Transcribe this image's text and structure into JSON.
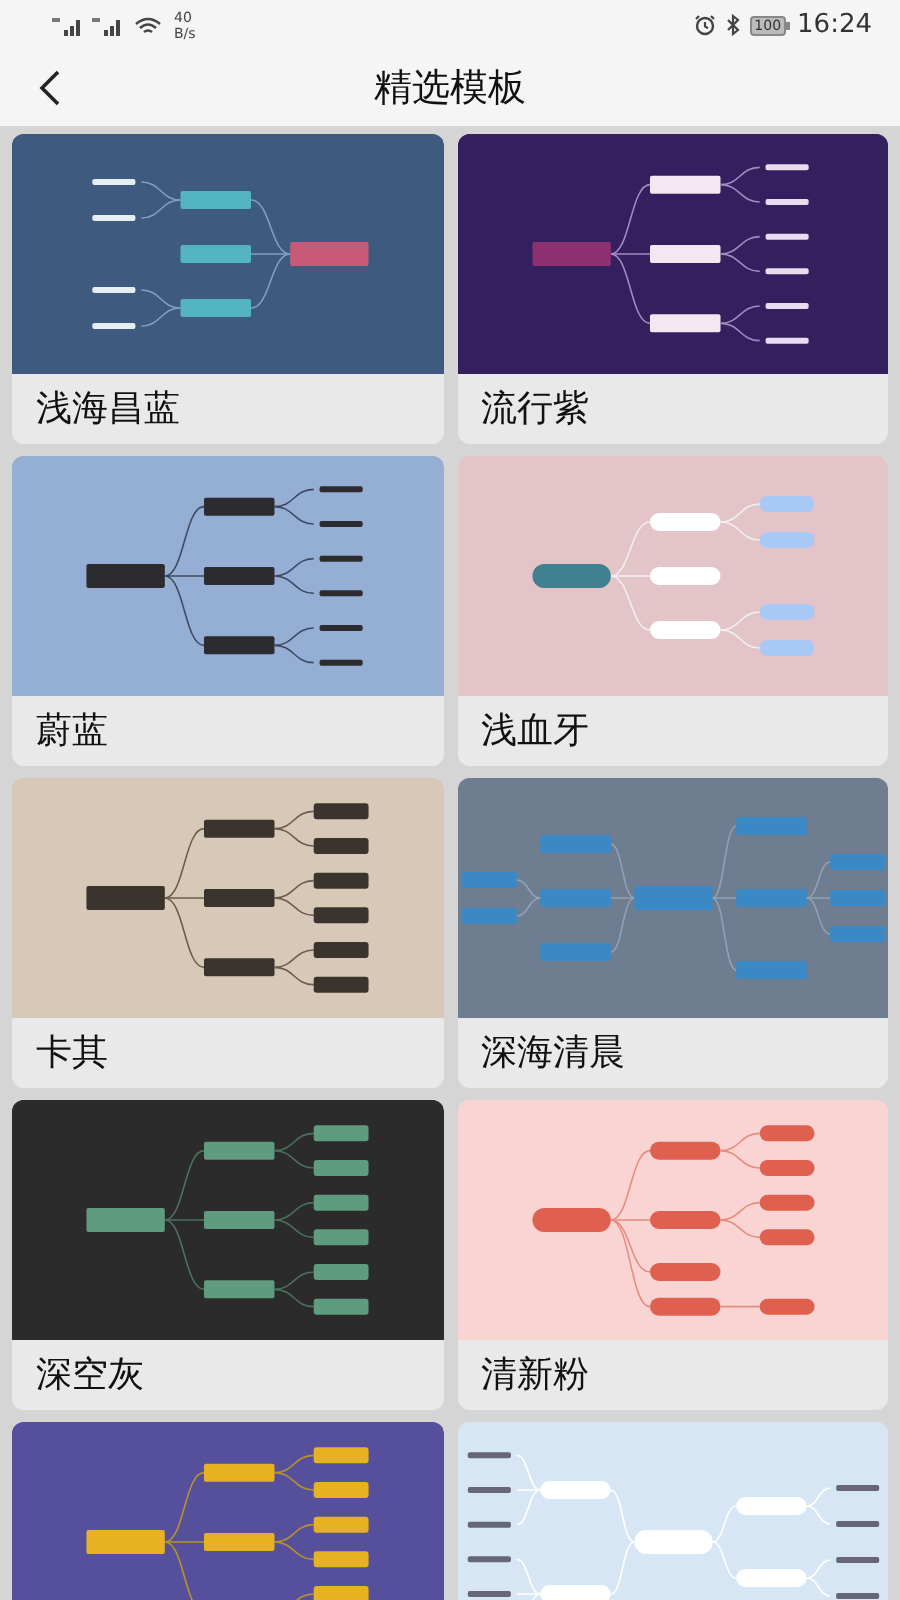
{
  "status_bar": {
    "network_speed": "40",
    "network_speed_unit": "B/s",
    "battery": "100",
    "time": "16:24"
  },
  "header": {
    "title": "精选模板"
  },
  "templates": [
    {
      "name": "浅海昌蓝",
      "color": "#3e5a7e"
    },
    {
      "name": "流行紫",
      "color": "#35205f"
    },
    {
      "name": "蔚蓝",
      "color": "#94aed4"
    },
    {
      "name": "浅血牙",
      "color": "#e3c5c9"
    },
    {
      "name": "卡其",
      "color": "#d8c8b7"
    },
    {
      "name": "深海清晨",
      "color": "#6e7e90"
    },
    {
      "name": "深空灰",
      "color": "#2b2b2b"
    },
    {
      "name": "清新粉",
      "color": "#f9d4d3"
    },
    {
      "color": "#56509c"
    },
    {
      "color": "#d6e6f4"
    }
  ]
}
